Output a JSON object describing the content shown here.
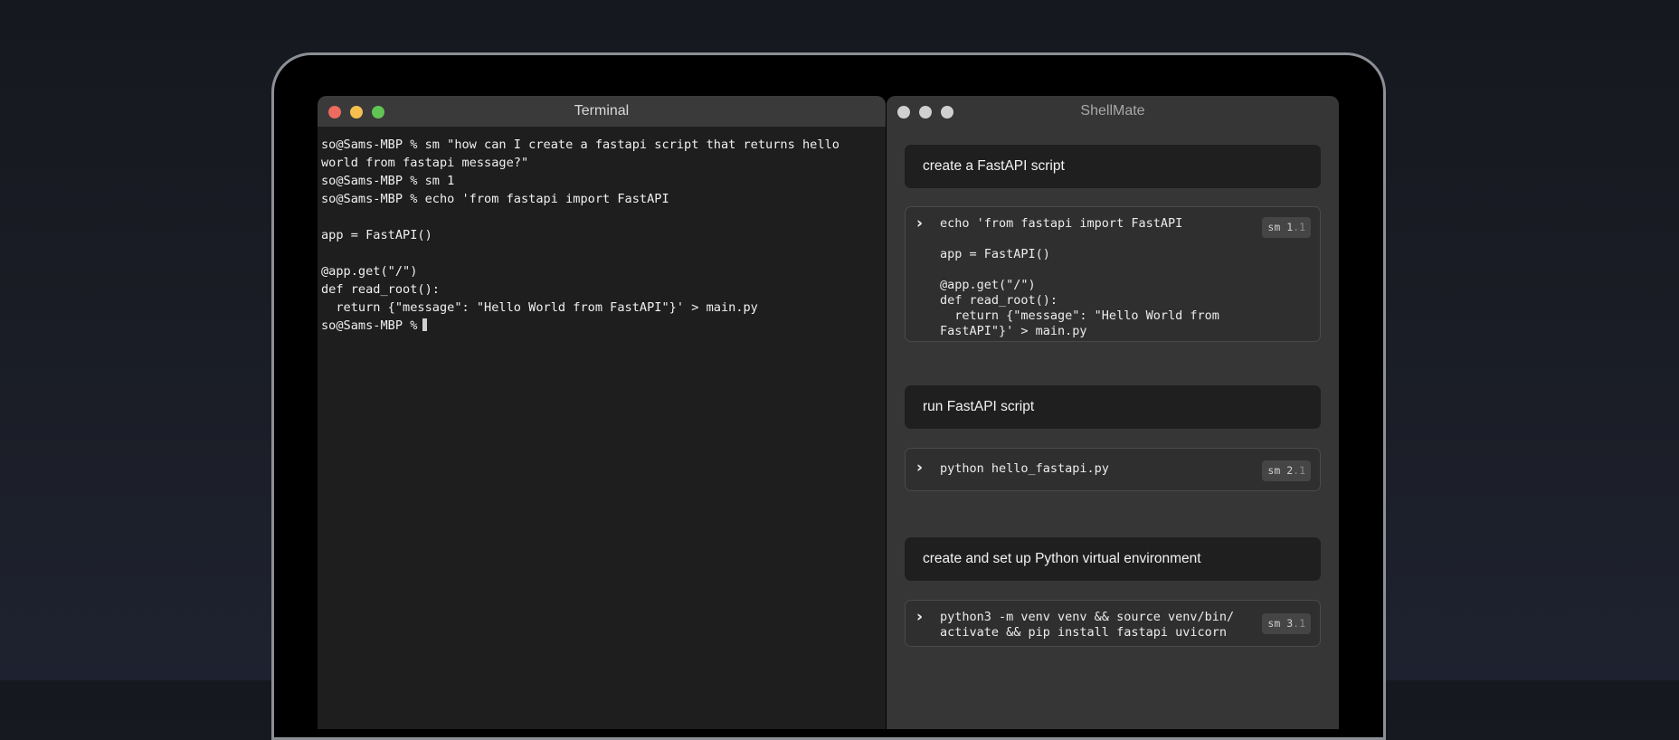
{
  "terminal": {
    "title": "Terminal",
    "lines": [
      "so@Sams-MBP % sm \"how can I create a fastapi script that returns hello",
      "world from fastapi message?\"",
      "so@Sams-MBP % sm 1",
      "so@Sams-MBP % echo 'from fastapi import FastAPI",
      "",
      "app = FastAPI()",
      "",
      "@app.get(\"/\")",
      "def read_root():",
      "  return {\"message\": \"Hello World from FastAPI\"}' > main.py",
      "so@Sams-MBP %"
    ]
  },
  "shellmate": {
    "title": "ShellMate",
    "suggestions": [
      {
        "title": "create a FastAPI script",
        "command": "echo 'from fastapi import FastAPI\n\napp = FastAPI()\n\n@app.get(\"/\")\ndef read_root():\n  return {\"message\": \"Hello World from\nFastAPI\"}' > main.py",
        "badge_prefix": "sm",
        "badge_main": "1",
        "badge_sub": ".1"
      },
      {
        "title": "run FastAPI script",
        "command": "python hello_fastapi.py",
        "badge_prefix": "sm",
        "badge_main": "2",
        "badge_sub": ".1"
      },
      {
        "title": "create and set up Python virtual environment",
        "command": "python3 -m venv venv && source venv/bin/\nactivate && pip install fastapi uvicorn",
        "badge_prefix": "sm",
        "badge_main": "3",
        "badge_sub": ".1"
      }
    ]
  },
  "colors": {
    "close": "#ec6a5e",
    "minimize": "#f4bf4f",
    "maximize": "#61c554",
    "inactive_light": "#d0d0d0"
  },
  "icons": {
    "run": "chevron-right-icon"
  }
}
